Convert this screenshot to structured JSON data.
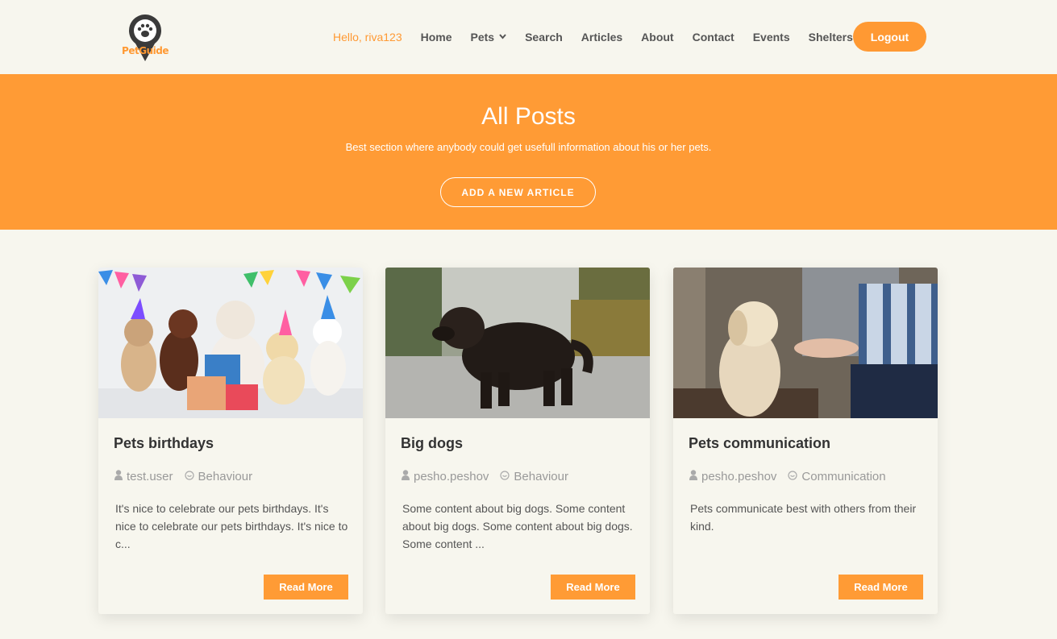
{
  "brand": {
    "logo_text": "PetGuide"
  },
  "nav": {
    "greeting": "Hello, riva123",
    "items": [
      "Home",
      "Pets",
      "Search",
      "Articles",
      "About",
      "Contact",
      "Events",
      "Shelters"
    ],
    "logout": "Logout"
  },
  "hero": {
    "title": "All Posts",
    "subtitle": "Best section where anybody could get usefull information about his or her pets.",
    "button": "ADD A NEW ARTICLE"
  },
  "posts": [
    {
      "title": "Pets birthdays",
      "author": "test.user",
      "category": "Behaviour",
      "excerpt": "It's nice to celebrate our pets birthdays. It's nice to celebrate our pets birthdays. It's nice to c...",
      "read_more": "Read More"
    },
    {
      "title": "Big dogs",
      "author": "pesho.peshov",
      "category": "Behaviour",
      "excerpt": "Some content about big dogs. Some content about big dogs. Some content about big dogs. Some content ...",
      "read_more": "Read More"
    },
    {
      "title": "Pets communication",
      "author": "pesho.peshov",
      "category": "Communication",
      "excerpt": "Pets communicate best with others from their kind.",
      "read_more": "Read More"
    }
  ],
  "colors": {
    "accent": "#ff9b35",
    "background": "#f7f6ee"
  },
  "icons": {
    "user": "user-icon",
    "category": "clock-icon",
    "dropdown": "chevron-down-icon"
  }
}
